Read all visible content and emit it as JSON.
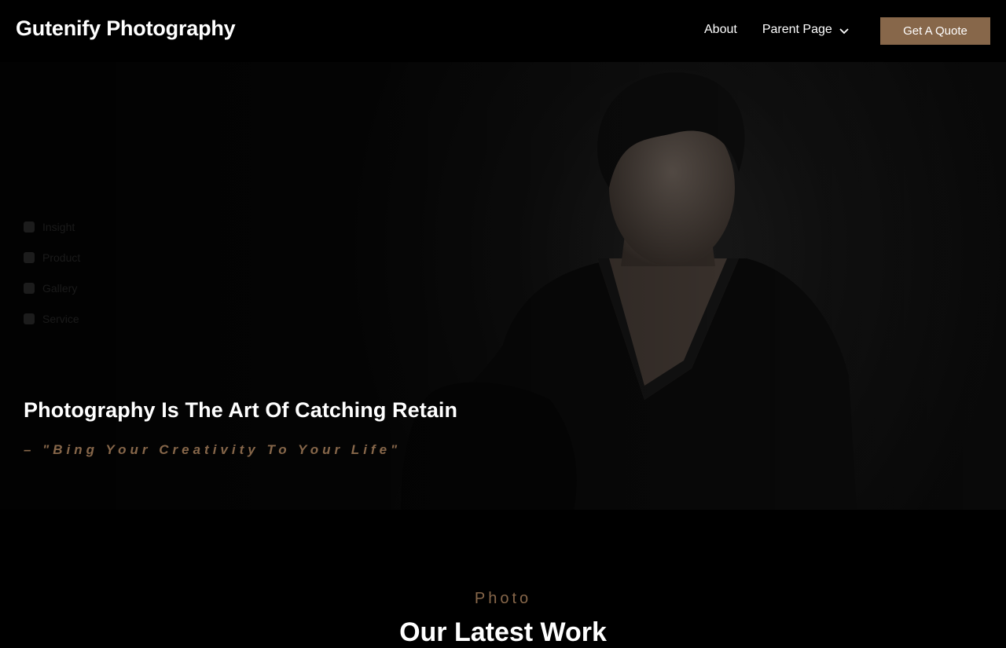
{
  "header": {
    "brand": "Gutenify Photography",
    "nav": [
      {
        "label": "About"
      },
      {
        "label": "Parent Page",
        "has_dropdown": true,
        "icon": "chevron-down-icon"
      }
    ],
    "cta_label": "Get A Quote"
  },
  "hero": {
    "side_links": [
      "Insight",
      "Product",
      "Gallery",
      "Service"
    ],
    "title": "Photography Is The Art Of Catching Retain",
    "quote": "– \"Bing Your Creativity To Your Life\""
  },
  "section": {
    "label": "Photo",
    "title": "Our Latest Work"
  },
  "colors": {
    "accent": "#87674a",
    "background": "#000000",
    "text": "#ffffff"
  }
}
